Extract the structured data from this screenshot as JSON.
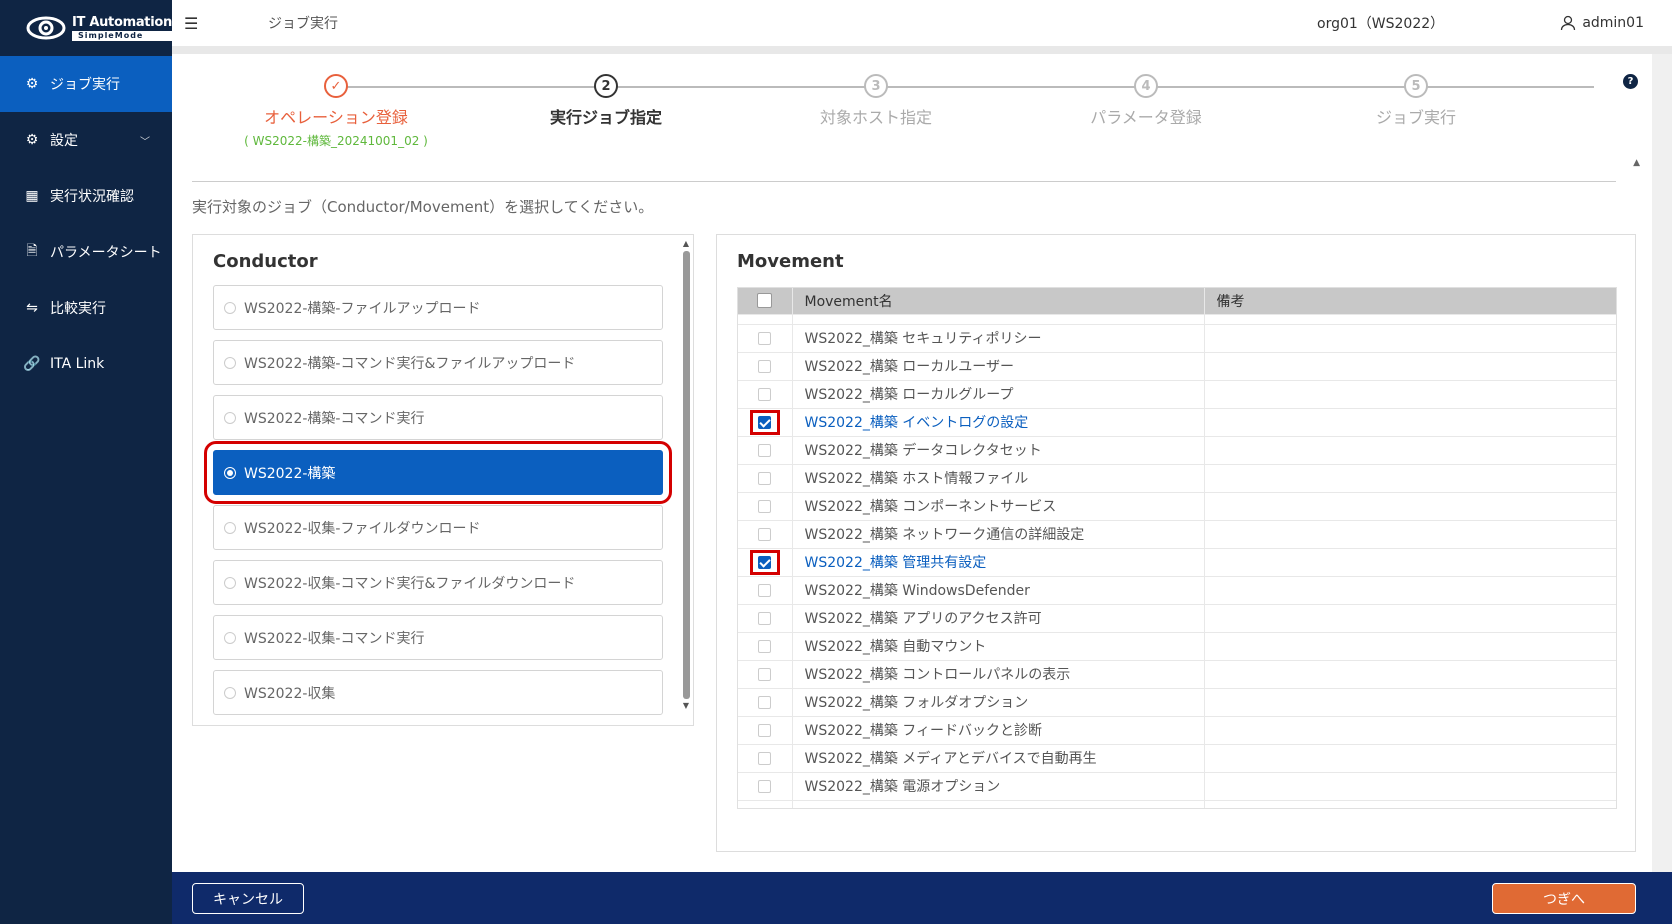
{
  "app": {
    "logo_title": "IT Automation",
    "logo_sub": "SimpleMode"
  },
  "sidebar": {
    "items": [
      {
        "label": "ジョブ実行",
        "icon": "gear-icon",
        "active": true
      },
      {
        "label": "設定",
        "icon": "settings-icon",
        "has_chevron": true
      },
      {
        "label": "実行状況確認",
        "icon": "grid-icon"
      },
      {
        "label": "パラメータシート",
        "icon": "document-icon"
      },
      {
        "label": "比較実行",
        "icon": "compare-icon"
      },
      {
        "label": "ITA Link",
        "icon": "link-icon"
      }
    ]
  },
  "header": {
    "title": "ジョブ実行",
    "org": "org01（WS2022）",
    "user": "admin01"
  },
  "stepper": {
    "steps": [
      {
        "num": "✓",
        "label": "オペレーション登録",
        "sub": "( WS2022-構築_20241001_02 )",
        "state": "done"
      },
      {
        "num": "2",
        "label": "実行ジョブ指定",
        "state": "current"
      },
      {
        "num": "3",
        "label": "対象ホスト指定",
        "state": "todo"
      },
      {
        "num": "4",
        "label": "パラメータ登録",
        "state": "todo"
      },
      {
        "num": "5",
        "label": "ジョブ実行",
        "state": "todo"
      }
    ],
    "help": "?"
  },
  "instruction": "実行対象のジョブ（Conductor/Movement）を選択してください。",
  "conductor": {
    "title": "Conductor",
    "items": [
      "WS2022-構築-ファイルアップロード",
      "WS2022-構築-コマンド実行&ファイルアップロード",
      "WS2022-構築-コマンド実行",
      "WS2022-構築",
      "WS2022-収集-ファイルダウンロード",
      "WS2022-収集-コマンド実行&ファイルダウンロード",
      "WS2022-収集-コマンド実行",
      "WS2022-収集"
    ],
    "selected_index": 3
  },
  "movement": {
    "title": "Movement",
    "columns": {
      "name": "Movement名",
      "note": "備考"
    },
    "rows": [
      {
        "name": "WS2022_構築 セキュリティポリシー",
        "checked": false
      },
      {
        "name": "WS2022_構築 ローカルユーザー",
        "checked": false
      },
      {
        "name": "WS2022_構築 ローカルグループ",
        "checked": false
      },
      {
        "name": "WS2022_構築 イベントログの設定",
        "checked": true
      },
      {
        "name": "WS2022_構築 データコレクタセット",
        "checked": false
      },
      {
        "name": "WS2022_構築 ホスト情報ファイル",
        "checked": false
      },
      {
        "name": "WS2022_構築 コンポーネントサービス",
        "checked": false
      },
      {
        "name": "WS2022_構築 ネットワーク通信の詳細設定",
        "checked": false
      },
      {
        "name": "WS2022_構築 管理共有設定",
        "checked": true
      },
      {
        "name": "WS2022_構築 WindowsDefender",
        "checked": false
      },
      {
        "name": "WS2022_構築 アプリのアクセス許可",
        "checked": false
      },
      {
        "name": "WS2022_構築 自動マウント",
        "checked": false
      },
      {
        "name": "WS2022_構築 コントロールパネルの表示",
        "checked": false
      },
      {
        "name": "WS2022_構築 フォルダオプション",
        "checked": false
      },
      {
        "name": "WS2022_構築 フィードバックと診断",
        "checked": false
      },
      {
        "name": "WS2022_構築 メディアとデバイスで自動再生",
        "checked": false
      },
      {
        "name": "WS2022_構築 電源オプション",
        "checked": false
      }
    ]
  },
  "footer": {
    "cancel_label": "キャンセル",
    "next_label": "つぎへ"
  },
  "colors": {
    "sidebar_bg": "#0f2544",
    "active": "#0b5fbf",
    "done_step": "#e8603c",
    "accent_orange": "#e06a34",
    "footer_bg": "#0f2a6a",
    "highlight": "#d40000"
  }
}
